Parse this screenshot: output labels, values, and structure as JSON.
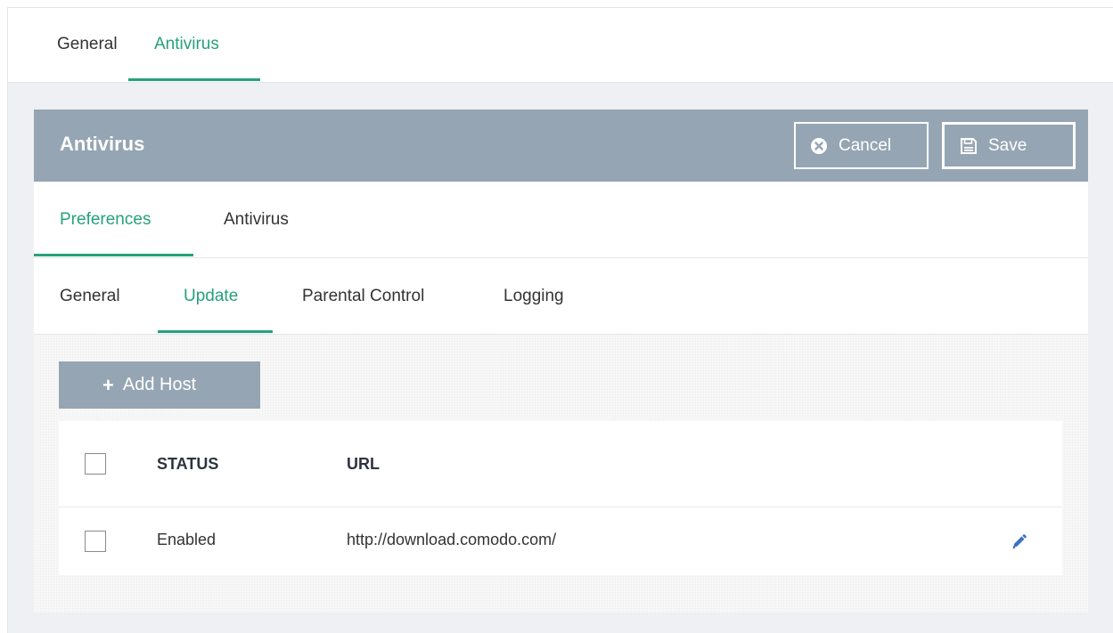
{
  "top_tabs": [
    {
      "label": "General",
      "active": false
    },
    {
      "label": "Antivirus",
      "active": true
    }
  ],
  "panel": {
    "title": "Antivirus",
    "cancel_label": "Cancel",
    "save_label": "Save"
  },
  "sub_tabs": [
    {
      "label": "Preferences",
      "active": true
    },
    {
      "label": "Antivirus",
      "active": false
    }
  ],
  "subsub_tabs": [
    {
      "label": "General",
      "active": false
    },
    {
      "label": "Update",
      "active": true
    },
    {
      "label": "Parental Control",
      "active": false
    },
    {
      "label": "Logging",
      "active": false
    }
  ],
  "add_host_label": "Add Host",
  "table": {
    "headers": {
      "status": "STATUS",
      "url": "URL"
    },
    "rows": [
      {
        "status": "Enabled",
        "url": "http://download.comodo.com/"
      }
    ]
  },
  "colors": {
    "accent": "#26a17b",
    "header_bg": "#95a5b3",
    "edit_icon": "#3b6fc4"
  },
  "icons": {
    "cancel": "x-circle-icon",
    "save": "floppy-disk-icon",
    "add": "plus-icon",
    "edit": "pencil-icon"
  }
}
